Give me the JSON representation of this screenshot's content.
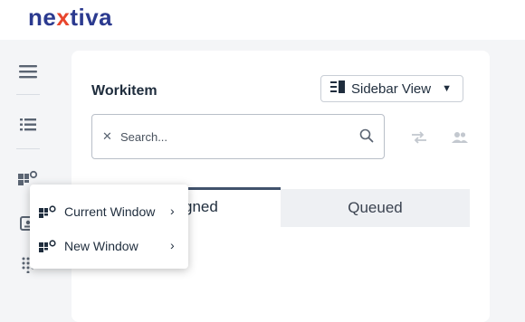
{
  "brand": {
    "part1": "ne",
    "part2": "x",
    "part3": "tiva"
  },
  "workitem": {
    "title": "Workitem",
    "view_select": "Sidebar View",
    "search_placeholder": "Search...",
    "tabs": [
      {
        "label": "gned"
      },
      {
        "label": "Queued"
      }
    ]
  },
  "popup_menu": {
    "items": [
      {
        "label": "Current Window",
        "chevron": "›"
      },
      {
        "label": "New Window",
        "chevron": "›"
      }
    ]
  },
  "icons": {
    "rail": [
      "hamburger-icon",
      "list-icon",
      "widget-window-icon",
      "contact-card-icon",
      "dialpad-icon"
    ],
    "actions": [
      "transfer-icon",
      "people-icon"
    ]
  },
  "colors": {
    "brand_blue": "#2b3a8f",
    "brand_orange": "#e8452c",
    "tab_active_border": "#41526c"
  }
}
